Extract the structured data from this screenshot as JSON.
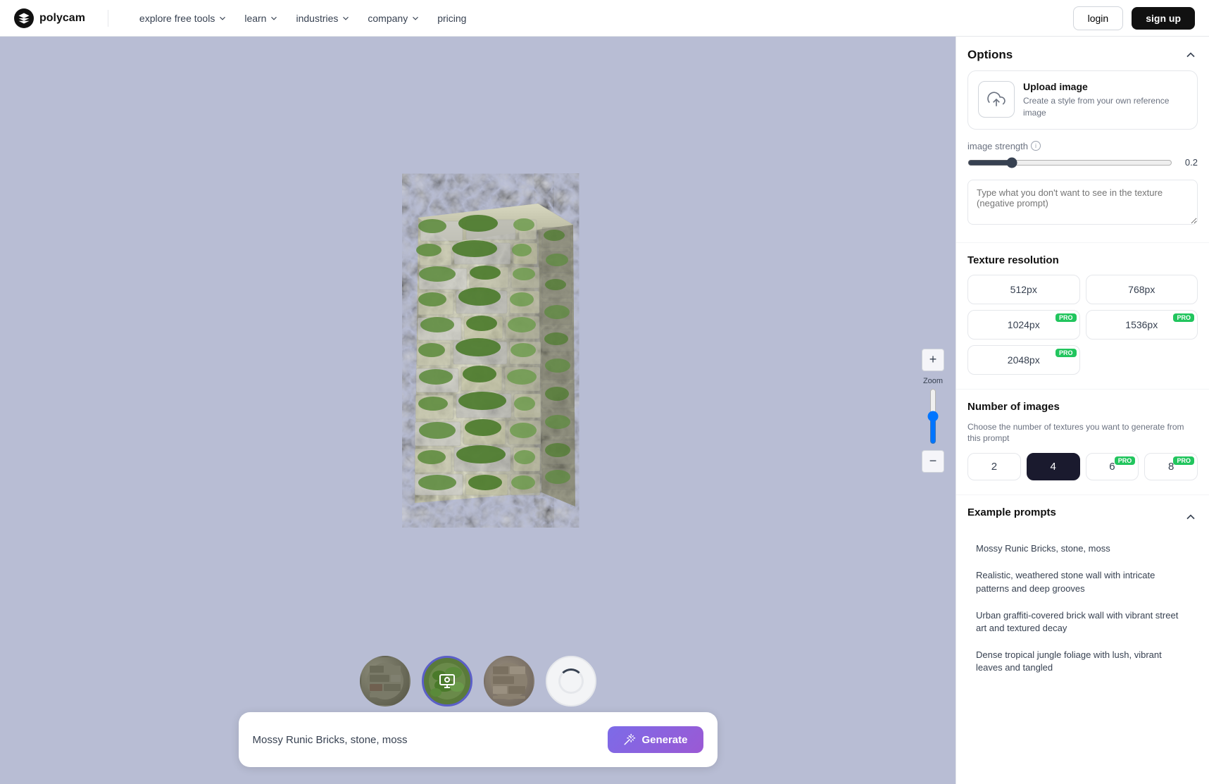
{
  "nav": {
    "logo_text": "polycam",
    "links": [
      {
        "label": "explore free tools",
        "has_dropdown": true
      },
      {
        "label": "learn",
        "has_dropdown": true
      },
      {
        "label": "industries",
        "has_dropdown": true
      },
      {
        "label": "company",
        "has_dropdown": true
      },
      {
        "label": "pricing",
        "has_dropdown": false
      }
    ],
    "login_label": "login",
    "signup_label": "sign up"
  },
  "sidebar": {
    "options_title": "Options",
    "upload": {
      "title": "Upload image",
      "description": "Create a style from your own reference image"
    },
    "image_strength": {
      "label": "image strength",
      "value": "0.2",
      "min": 0,
      "max": 1,
      "step": 0.1
    },
    "negative_prompt": {
      "placeholder": "Type what you don't want to see in the texture (negative prompt)"
    },
    "texture_resolution": {
      "title": "Texture resolution",
      "options": [
        {
          "label": "512px",
          "selected": false,
          "pro": false
        },
        {
          "label": "768px",
          "selected": false,
          "pro": false
        },
        {
          "label": "1024px",
          "selected": false,
          "pro": true
        },
        {
          "label": "1536px",
          "selected": false,
          "pro": true
        },
        {
          "label": "2048px",
          "selected": false,
          "pro": true
        }
      ]
    },
    "number_of_images": {
      "title": "Number of images",
      "description": "Choose the number of textures you want to generate from this prompt",
      "options": [
        {
          "label": "2",
          "selected": false,
          "pro": false
        },
        {
          "label": "4",
          "selected": true,
          "pro": false
        },
        {
          "label": "6",
          "selected": false,
          "pro": true
        },
        {
          "label": "8",
          "selected": false,
          "pro": true
        }
      ]
    },
    "example_prompts": {
      "title": "Example prompts",
      "items": [
        {
          "text": "Mossy Runic Bricks, stone, moss"
        },
        {
          "text": "Realistic, weathered stone wall with intricate patterns and deep grooves"
        },
        {
          "text": "Urban graffiti-covered brick wall with vibrant street art and textured decay"
        },
        {
          "text": "Dense tropical jungle foliage with lush, vibrant leaves and tangled"
        }
      ]
    }
  },
  "prompt": {
    "value": "Mossy Runic Bricks, stone, moss",
    "generate_label": "Generate"
  },
  "zoom": {
    "label": "Zoom",
    "value": 0.5
  },
  "thumbnails": [
    {
      "type": "stone",
      "active": false
    },
    {
      "type": "mossy_active",
      "active": true
    },
    {
      "type": "stone2",
      "active": false
    },
    {
      "type": "loading",
      "active": false
    }
  ]
}
